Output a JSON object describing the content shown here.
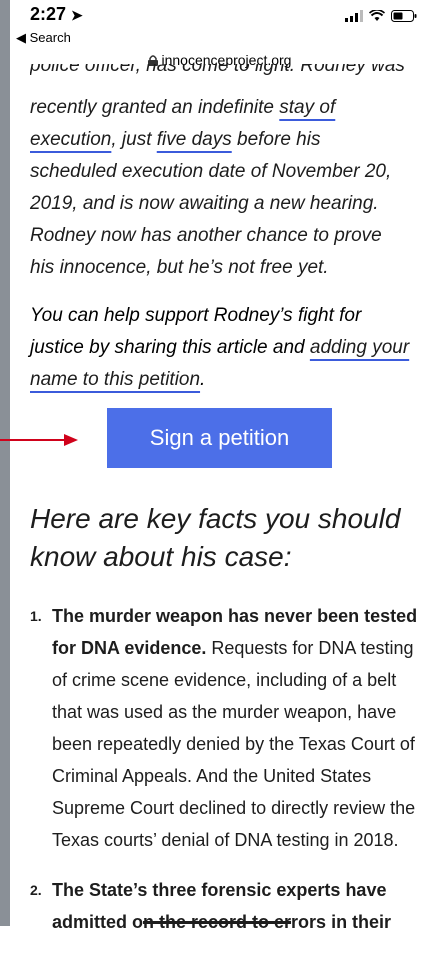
{
  "status": {
    "time": "2:27",
    "back_label": "◀ Search",
    "url": "innocenceproject.org"
  },
  "article": {
    "cut_line": "police officer, has come to light. Rodney was",
    "p1_a": "recently granted an indefinite ",
    "p1_link1": "stay of execution",
    "p1_b": ", just ",
    "p1_link2": "five days",
    "p1_c": " before his scheduled execution date of November 20, 2019, and is now awaiting a new hearing. Rodney now has another chance to prove his innocence, but he’s not free yet.",
    "p2_a": "You can help support Rodney’s fight for justice by sharing this article and ",
    "p2_link": "adding your name to this petition",
    "p2_b": "."
  },
  "cta": {
    "label": "Sign a petition"
  },
  "facts": {
    "heading": "Here are key facts you should know about his case:",
    "items": [
      {
        "num": "1.",
        "bold": "The murder weapon has never been tested for DNA evidence.",
        "text": " Requests for DNA testing of crime scene evidence, including of a belt that was used as the murder weapon, have been repeatedly denied by the Texas Court of Criminal Appeals. And the United States Supreme Court declined to directly review the Texas courts’ denial of DNA testing in 2018."
      },
      {
        "num": "2.",
        "bold_a": "The State’s three forensic experts have admitted o",
        "bold_strike": "n the record to er",
        "bold_b": "rors in their"
      }
    ]
  },
  "colors": {
    "accent": "#4c6fe8",
    "arrow": "#d0021b"
  }
}
